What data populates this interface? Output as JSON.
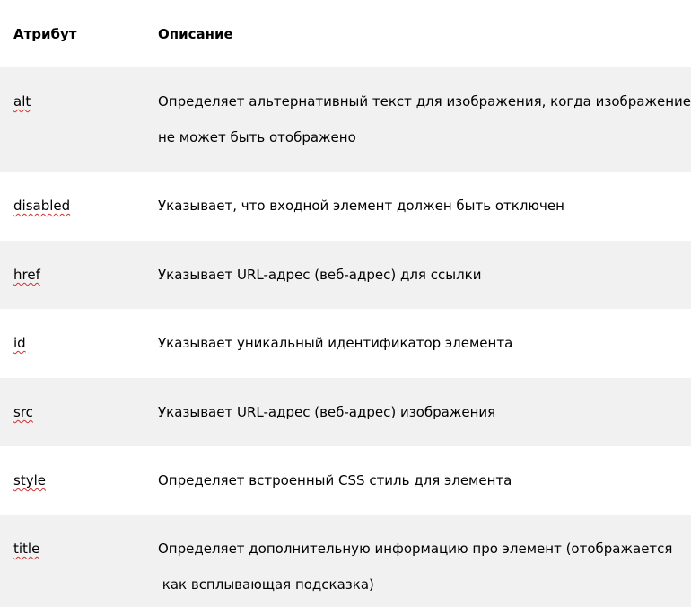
{
  "header": {
    "attribute": "Атрибут",
    "description": "Описание"
  },
  "rows": [
    {
      "attribute": "alt",
      "description_lines": [
        "Определяет альтернативный текст для изображения, когда изображение",
        "не может быть отображено"
      ]
    },
    {
      "attribute": "disabled",
      "description_lines": [
        "Указывает, что входной элемент должен быть отключен"
      ]
    },
    {
      "attribute": "href",
      "description_lines": [
        "Указывает URL-адрес (веб-адрес) для ссылки"
      ]
    },
    {
      "attribute": "id",
      "description_lines": [
        "Указывает уникальный идентификатор элемента"
      ]
    },
    {
      "attribute": "src",
      "description_lines": [
        "Указывает URL-адрес (веб-адрес) изображения"
      ]
    },
    {
      "attribute": "style",
      "description_lines": [
        "Определяет встроенный CSS стиль для элемента"
      ]
    },
    {
      "attribute": "title",
      "description_lines": [
        "Определяет дополнительную информацию про элемент (отображается",
        " как всплывающая подсказка)"
      ]
    }
  ],
  "colors": {
    "shaded_row": "#f1f1f1",
    "plain_row": "#ffffff",
    "spellcheck_underline": "#d03030"
  }
}
